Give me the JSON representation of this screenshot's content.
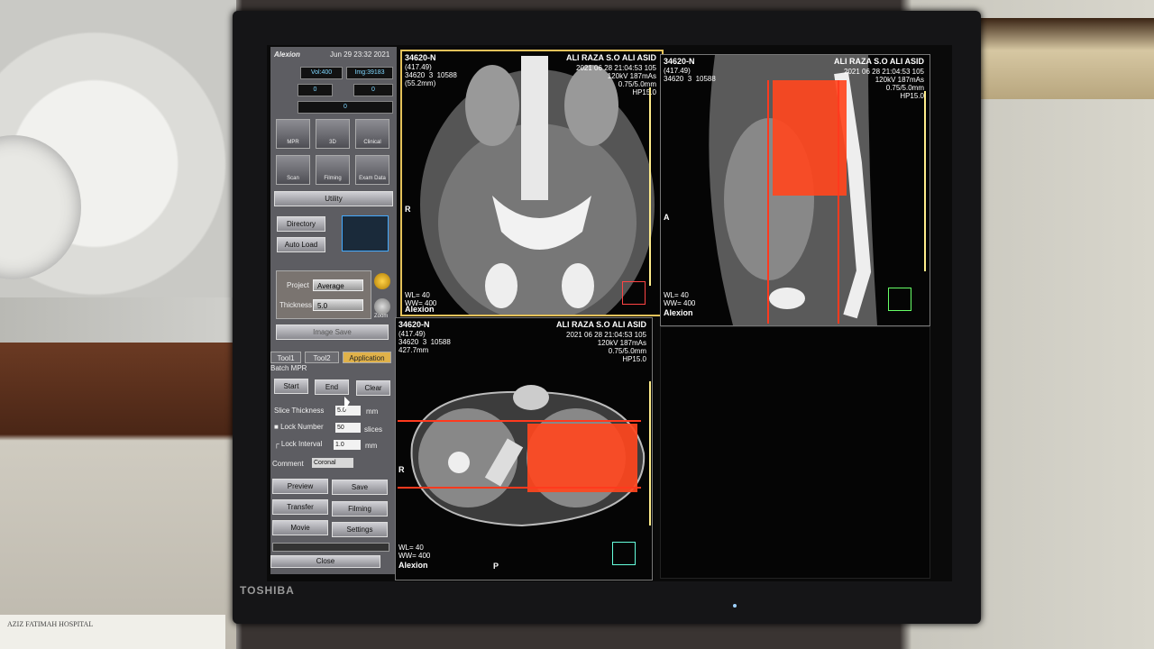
{
  "surroundings": {
    "paper_text": "AZIZ FATIMAH HOSPITAL",
    "monitor_brand": "TOSHIBA"
  },
  "panel": {
    "logo": "Alexion",
    "datetime": "Jun 29 23:32 2021",
    "fields": {
      "vol": "Vol:400",
      "img": "Img:39183",
      "f1": "0",
      "f2": "0",
      "f3": "0"
    },
    "mode_buttons": [
      {
        "label": "MPR",
        "icon": "mpr-icon"
      },
      {
        "label": "3D",
        "icon": "cube-icon"
      },
      {
        "label": "Clinical",
        "icon": "clinical-icon"
      }
    ],
    "tool_buttons": [
      {
        "label": "Scan",
        "icon": "scanner-icon"
      },
      {
        "label": "Filming",
        "icon": "film-icon"
      },
      {
        "label": "Exam Data",
        "icon": "data-icon"
      }
    ],
    "utility": "Utility",
    "directory": "Directory",
    "auto_load": "Auto Load",
    "project_label": "Project",
    "project_value": "Average",
    "thickness_label": "Thickness",
    "thickness_value": "5.0",
    "zoom_label": "Zoom",
    "image_save": "Image Save",
    "tabs": [
      "Tool1",
      "Tool2",
      "Application"
    ],
    "batch_label": "Batch MPR",
    "start": "Start",
    "end": "End",
    "clear": "Clear",
    "slice_thickness_label": "Slice Thickness",
    "slice_thickness_value": "5.0",
    "slice_unit": "mm",
    "lock_number_label": "Lock Number",
    "lock_number_value": "50",
    "lock_number_unit": "slices",
    "lock_interval_label": "Lock Interval",
    "lock_interval_value": "1.0",
    "lock_interval_unit": "mm",
    "comment_label": "Comment",
    "comment_value": "Coronal",
    "preview": "Preview",
    "save": "Save",
    "transfer": "Transfer",
    "filming": "Filming",
    "movie": "Movie",
    "settings": "Settings",
    "close": "Close"
  },
  "viewports": {
    "coronal": {
      "id": "34620-N",
      "sub": "(417.49)\n34620  3  10588\n(55.2mm)",
      "patient": "ALI RAZA S.O ALI ASID",
      "meta": "2021 06 28 21:04:53 105\n120kV 187mAs\n0.75/5.0mm\nHP15.0",
      "wl": "WL= 40\nWW= 400",
      "vendor": "Alexion",
      "left": "R"
    },
    "sagittal": {
      "id": "34620-N",
      "sub": "(417.49)\n34620  3  10588",
      "patient": "ALI RAZA S.O ALI ASID",
      "meta": "2021 06 28 21:04:53 105\n120kV 187mAs\n0.75/5.0mm\nHP15.0",
      "wl": "WL= 40\nWW= 400",
      "vendor": "Alexion",
      "left": "A"
    },
    "axial": {
      "id": "34620-N",
      "sub": "(417.49)\n34620  3  10588\n427.7mm",
      "patient": "ALI RAZA S.O ALI ASID",
      "meta": "2021 06 28 21:04:53 105\n120kV 187mAs\n0.75/5.0mm\nHP15.0",
      "wl": "WL= 40\nWW= 400",
      "vendor": "Alexion",
      "left": "R",
      "bottom": "P"
    }
  },
  "colors": {
    "accent": "#e5c25a",
    "overlay": "#ff461e",
    "panel": "#5d5d62"
  }
}
